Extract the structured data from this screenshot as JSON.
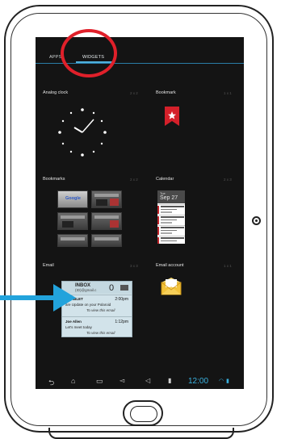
{
  "tabs": {
    "apps": "APPS",
    "widgets": "WIDGETS"
  },
  "widgets": [
    {
      "name": "Analog clock",
      "size": "2 x 2"
    },
    {
      "name": "Bookmark",
      "size": "1 x 1"
    },
    {
      "name": "Bookmarks",
      "size": "2 x 2"
    },
    {
      "name": "Calendar",
      "size": "2 x 3"
    },
    {
      "name": "Email",
      "size": "3 x 3"
    },
    {
      "name": "Email account",
      "size": "1 x 1"
    }
  ],
  "bookmark_thumb_label": "Google",
  "calendar": {
    "day": "Tue",
    "date": "Sep 27"
  },
  "email": {
    "inbox": "INBOX",
    "account": "(ID)@gmail.c",
    "count": "0",
    "messages": [
      {
        "sender": "D TABLET",
        "time": "2:00pm",
        "subject": "are Update on your Polaroid",
        "view": "To view this email"
      },
      {
        "sender": "Joe Allen",
        "time": "1:12pm",
        "subject": "Let's meet today",
        "view": "To view this email"
      }
    ]
  },
  "status": {
    "time": "12:00"
  },
  "colors": {
    "accent": "#3ab1df",
    "annotation_circle": "#e0202a",
    "annotation_arrow": "#22a3dc"
  }
}
